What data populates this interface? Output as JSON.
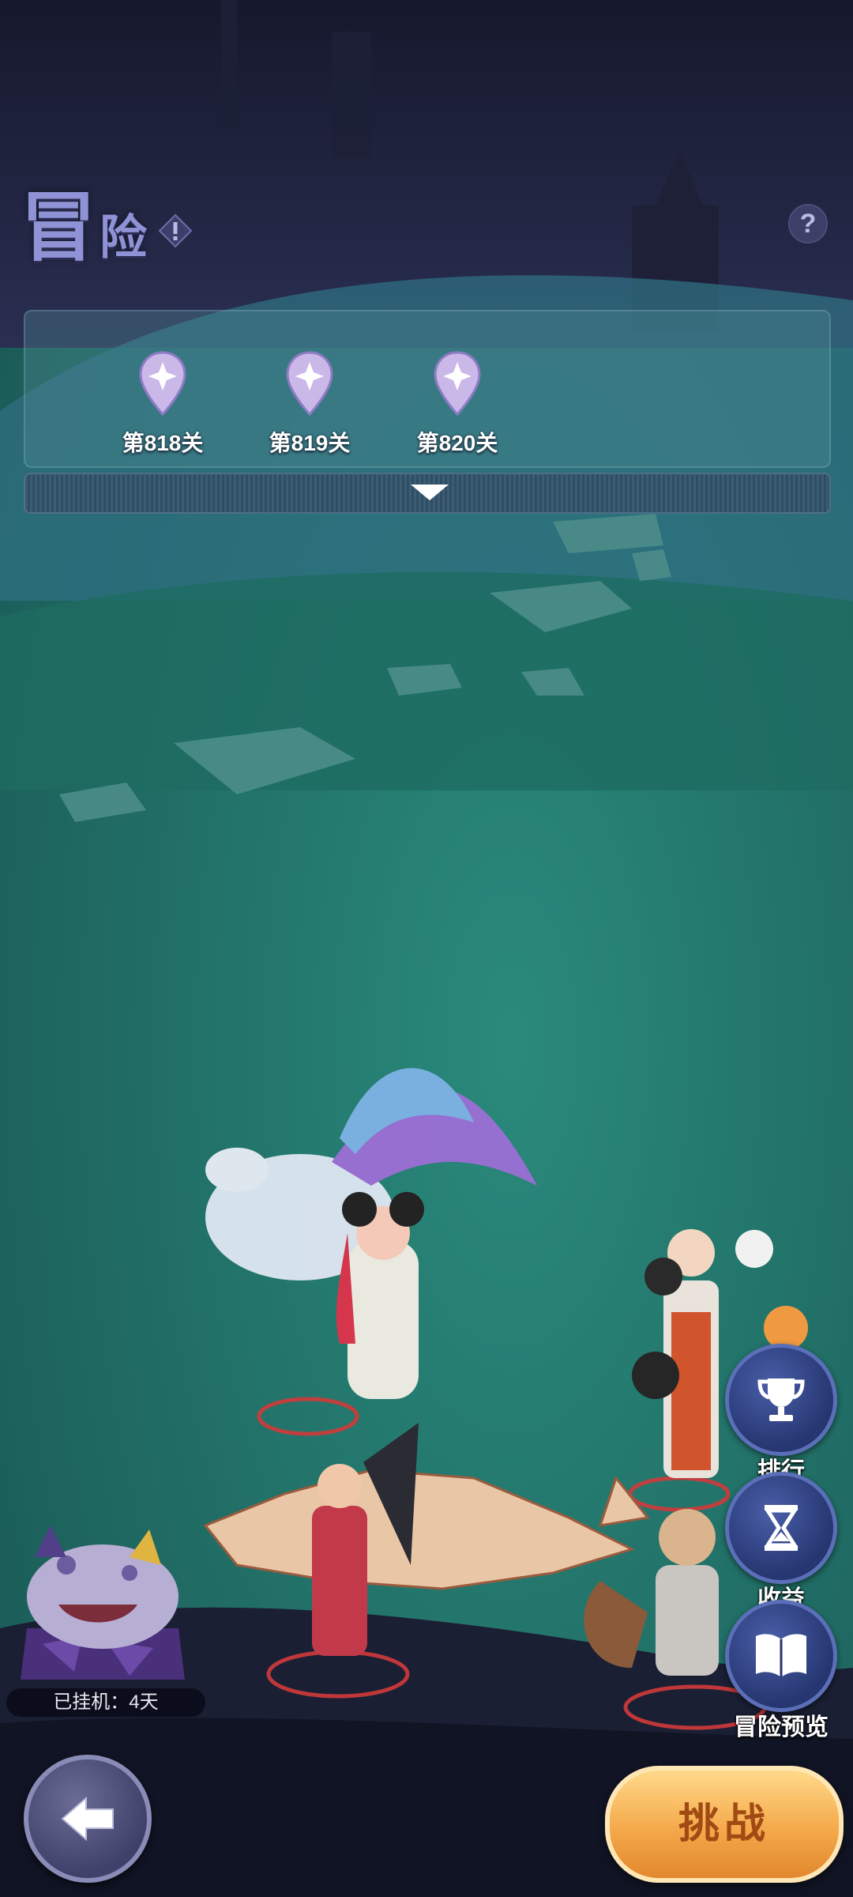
{
  "header": {
    "title_part1": "冒",
    "title_part2": "险"
  },
  "icons": {
    "warning": "exclamation-diamond-icon",
    "help": "question-mark-icon",
    "back": "left-arrow-icon",
    "rank": "trophy-icon",
    "income": "hourglass-icon",
    "preview": "open-book-icon"
  },
  "help_glyph": "?",
  "stages": [
    {
      "label": "第818关"
    },
    {
      "label": "第819关"
    },
    {
      "label": "第820关"
    }
  ],
  "side_buttons": {
    "rank": "排行",
    "income": "收益",
    "preview": "冒险预览"
  },
  "idle_status": "已挂机：4天",
  "challenge_button": "挑战",
  "colors": {
    "title": "#8f93d6",
    "button_blue": "#253670",
    "challenge_orange": "#f4a94a",
    "ground_teal": "#1f6a62"
  }
}
